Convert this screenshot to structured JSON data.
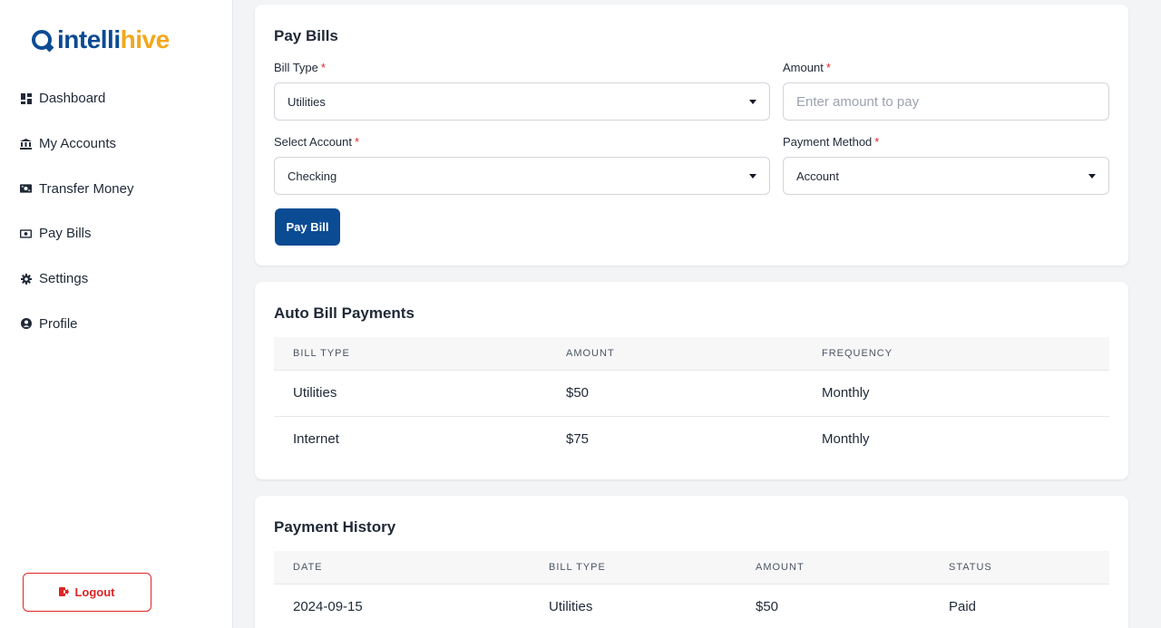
{
  "brand": {
    "part1": "intelli",
    "part2": "hive",
    "color_primary": "#0b4b94",
    "color_accent": "#f2a81d"
  },
  "sidebar": {
    "items": [
      {
        "label": "Dashboard",
        "icon": "dashboard-icon"
      },
      {
        "label": "My Accounts",
        "icon": "bank-icon"
      },
      {
        "label": "Transfer Money",
        "icon": "money-transfer-icon"
      },
      {
        "label": "Pay Bills",
        "icon": "bill-icon"
      },
      {
        "label": "Settings",
        "icon": "gear-icon"
      },
      {
        "label": "Profile",
        "icon": "user-circle-icon"
      }
    ],
    "logout_label": "Logout"
  },
  "pay_bills": {
    "title": "Pay Bills",
    "bill_type_label": "Bill Type",
    "bill_type_value": "Utilities",
    "amount_label": "Amount",
    "amount_placeholder": "Enter amount to pay",
    "account_label": "Select Account",
    "account_value": "Checking",
    "method_label": "Payment Method",
    "method_value": "Account",
    "required_mark": "*",
    "submit_label": "Pay Bill"
  },
  "auto_payments": {
    "title": "Auto Bill Payments",
    "columns": [
      "BILL TYPE",
      "AMOUNT",
      "FREQUENCY"
    ],
    "rows": [
      [
        "Utilities",
        "$50",
        "Monthly"
      ],
      [
        "Internet",
        "$75",
        "Monthly"
      ]
    ]
  },
  "history": {
    "title": "Payment History",
    "columns": [
      "DATE",
      "BILL TYPE",
      "AMOUNT",
      "STATUS"
    ],
    "rows": [
      [
        "2024-09-15",
        "Utilities",
        "$50",
        "Paid"
      ]
    ]
  }
}
